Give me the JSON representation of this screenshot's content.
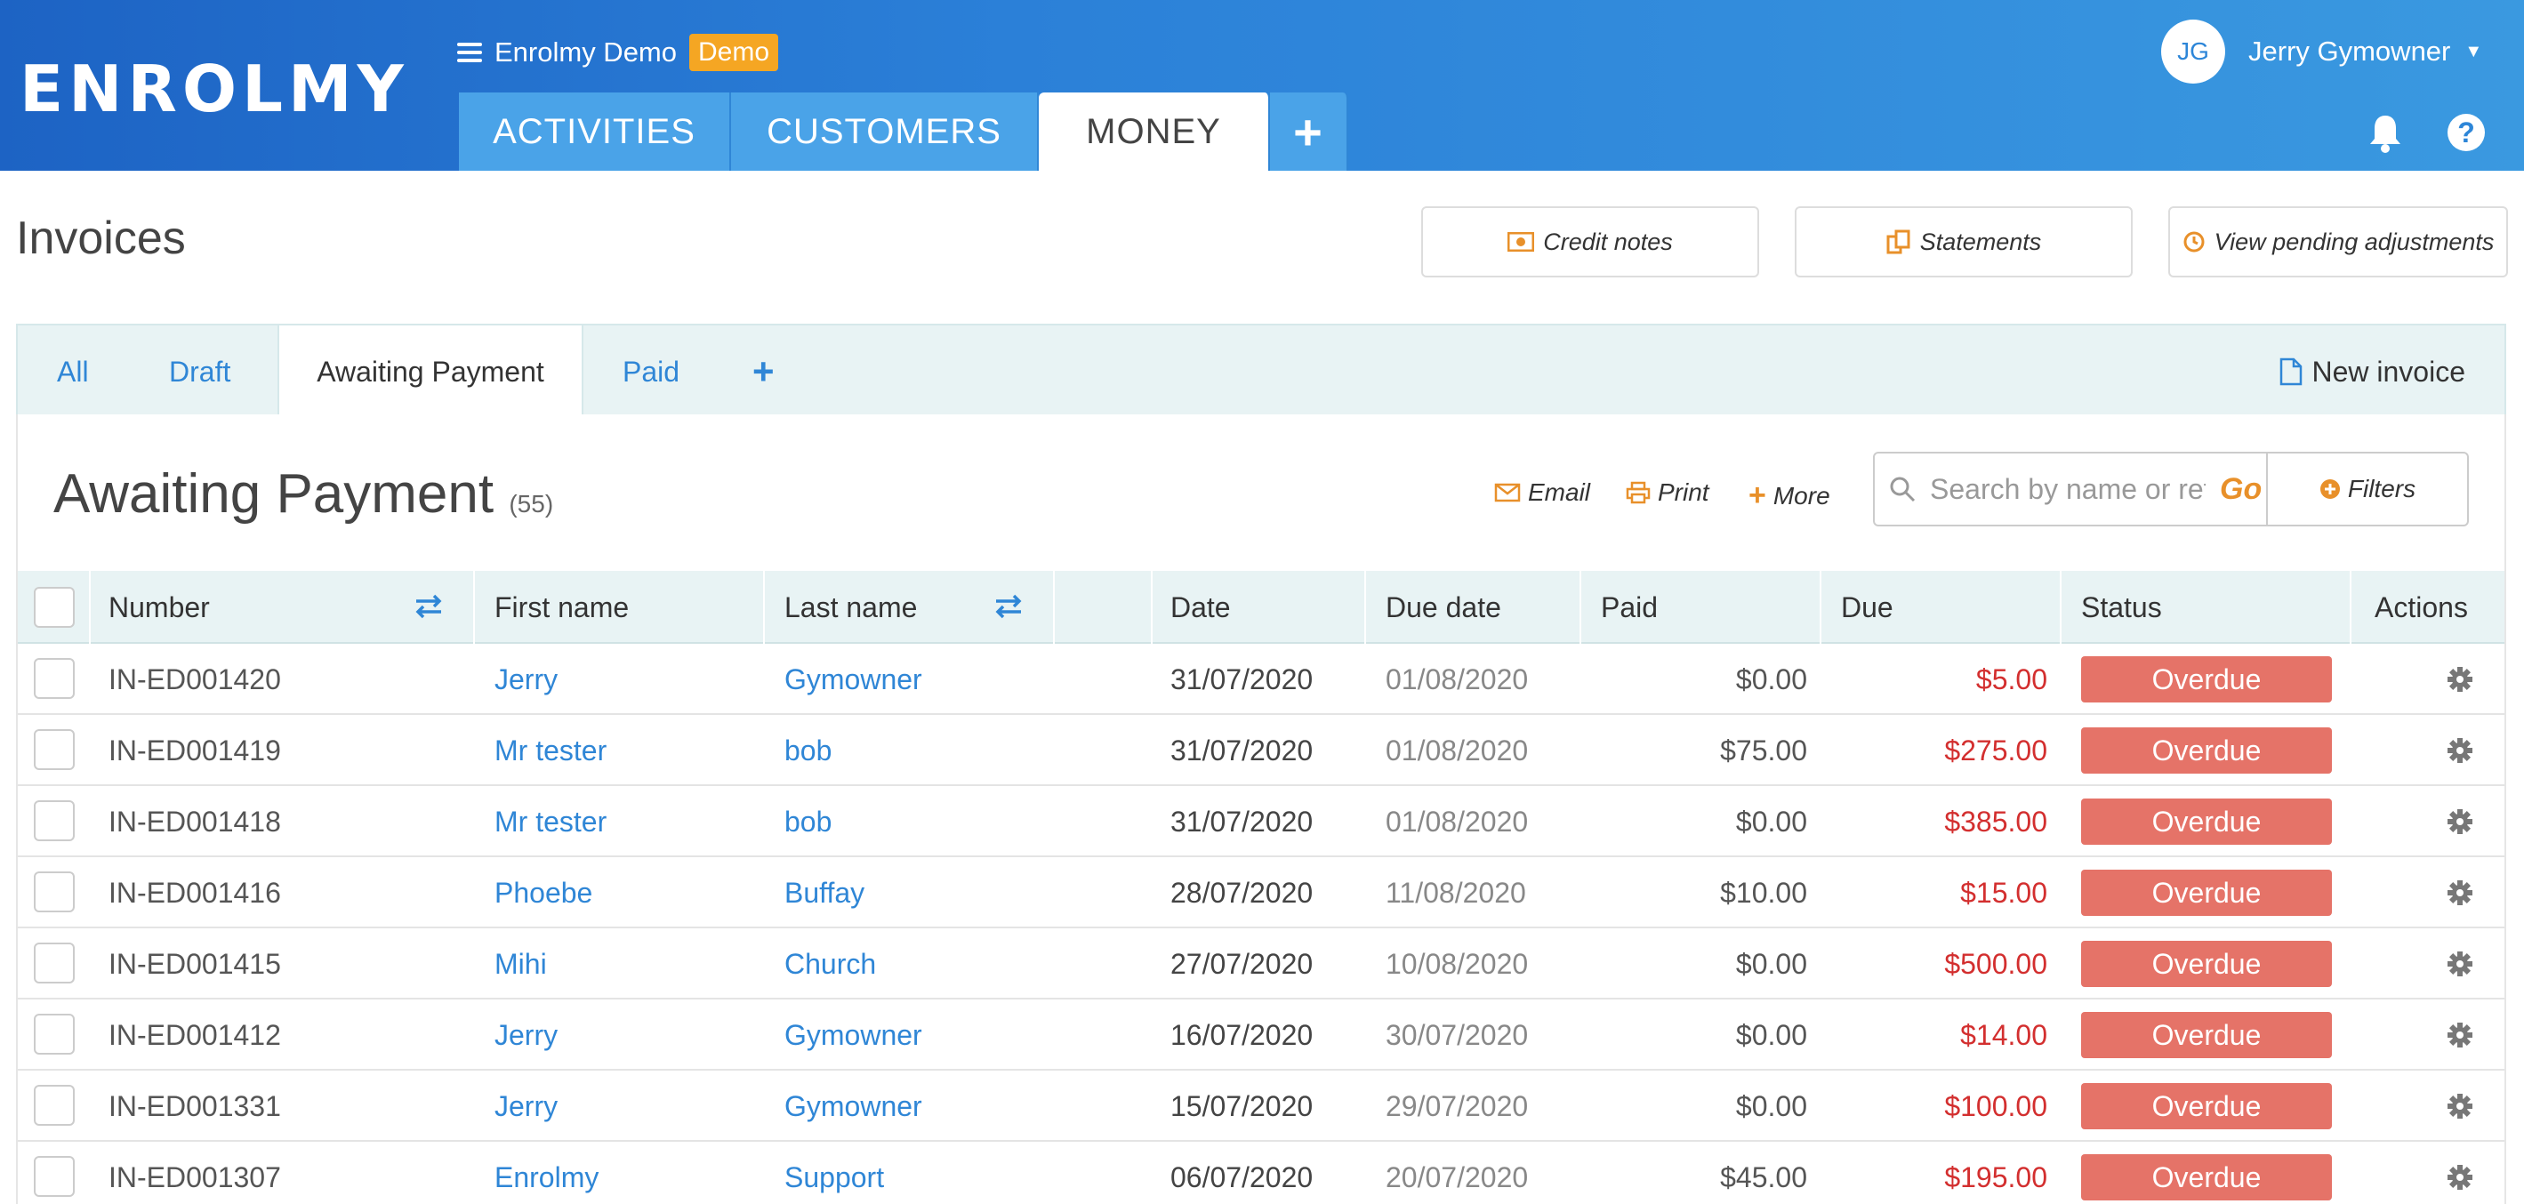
{
  "header": {
    "logo": "ENROLMY",
    "org_name": "Enrolmy Demo",
    "org_badge": "Demo",
    "tabs": [
      {
        "label": "ACTIVITIES"
      },
      {
        "label": "CUSTOMERS"
      },
      {
        "label": "MONEY"
      }
    ],
    "plus_label": "+",
    "user": {
      "initials": "JG",
      "name": "Jerry Gymowner"
    },
    "help_label": "?"
  },
  "page": {
    "title": "Invoices",
    "buttons": {
      "credit_notes": "Credit notes",
      "statements": "Statements",
      "pending": "View pending adjustments"
    }
  },
  "subtabs": {
    "items": [
      {
        "label": "All"
      },
      {
        "label": "Draft"
      },
      {
        "label": "Awaiting Payment"
      },
      {
        "label": "Paid"
      }
    ],
    "plus_label": "+",
    "new_invoice": "New invoice"
  },
  "section": {
    "title": "Awaiting Payment",
    "count": "(55)",
    "email": "Email",
    "print": "Print",
    "more": "More",
    "search_placeholder": "Search by name or ref",
    "go": "Go",
    "filters": "Filters"
  },
  "table": {
    "columns": {
      "number": "Number",
      "first": "First name",
      "last": "Last name",
      "date": "Date",
      "due_date": "Due date",
      "paid": "Paid",
      "due": "Due",
      "status": "Status",
      "actions": "Actions"
    },
    "rows": [
      {
        "number": "IN-ED001420",
        "first": "Jerry",
        "last": "Gymowner",
        "date": "31/07/2020",
        "due_date": "01/08/2020",
        "paid": "$0.00",
        "due": "$5.00",
        "status": "Overdue"
      },
      {
        "number": "IN-ED001419",
        "first": "Mr tester",
        "last": "bob",
        "date": "31/07/2020",
        "due_date": "01/08/2020",
        "paid": "$75.00",
        "due": "$275.00",
        "status": "Overdue"
      },
      {
        "number": "IN-ED001418",
        "first": "Mr tester",
        "last": "bob",
        "date": "31/07/2020",
        "due_date": "01/08/2020",
        "paid": "$0.00",
        "due": "$385.00",
        "status": "Overdue"
      },
      {
        "number": "IN-ED001416",
        "first": "Phoebe",
        "last": "Buffay",
        "date": "28/07/2020",
        "due_date": "11/08/2020",
        "paid": "$10.00",
        "due": "$15.00",
        "status": "Overdue"
      },
      {
        "number": "IN-ED001415",
        "first": "Mihi",
        "last": "Church",
        "date": "27/07/2020",
        "due_date": "10/08/2020",
        "paid": "$0.00",
        "due": "$500.00",
        "status": "Overdue"
      },
      {
        "number": "IN-ED001412",
        "first": "Jerry",
        "last": "Gymowner",
        "date": "16/07/2020",
        "due_date": "30/07/2020",
        "paid": "$0.00",
        "due": "$14.00",
        "status": "Overdue"
      },
      {
        "number": "IN-ED001331",
        "first": "Jerry",
        "last": "Gymowner",
        "date": "15/07/2020",
        "due_date": "29/07/2020",
        "paid": "$0.00",
        "due": "$100.00",
        "status": "Overdue"
      },
      {
        "number": "IN-ED001307",
        "first": "Enrolmy",
        "last": "Support",
        "date": "06/07/2020",
        "due_date": "20/07/2020",
        "paid": "$45.00",
        "due": "$195.00",
        "status": "Overdue"
      }
    ]
  },
  "colors": {
    "brand_blue": "#2b80d8",
    "link": "#2f86d6",
    "accent_orange": "#e8902a",
    "overdue": "#e57368",
    "due_red": "#d32f2f"
  }
}
